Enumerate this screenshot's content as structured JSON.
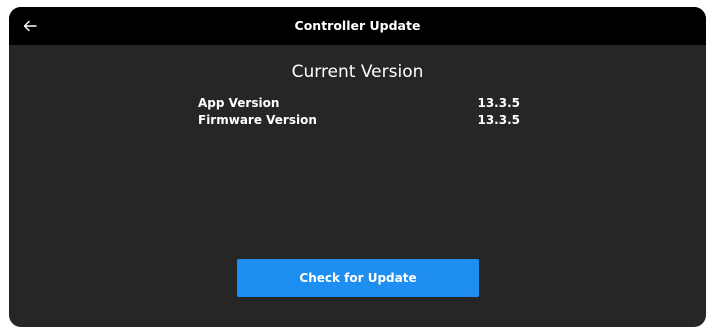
{
  "header": {
    "title": "Controller Update",
    "back_icon": "arrow-left-icon"
  },
  "current_version": {
    "heading": "Current Version",
    "rows": [
      {
        "label": "App Version",
        "value": "13.3.5"
      },
      {
        "label": "Firmware Version",
        "value": "13.3.5"
      }
    ]
  },
  "actions": {
    "check_label": "Check for Update"
  },
  "colors": {
    "background": "#262626",
    "header": "#000000",
    "accent": "#1e8ff0",
    "text": "#ffffff"
  }
}
